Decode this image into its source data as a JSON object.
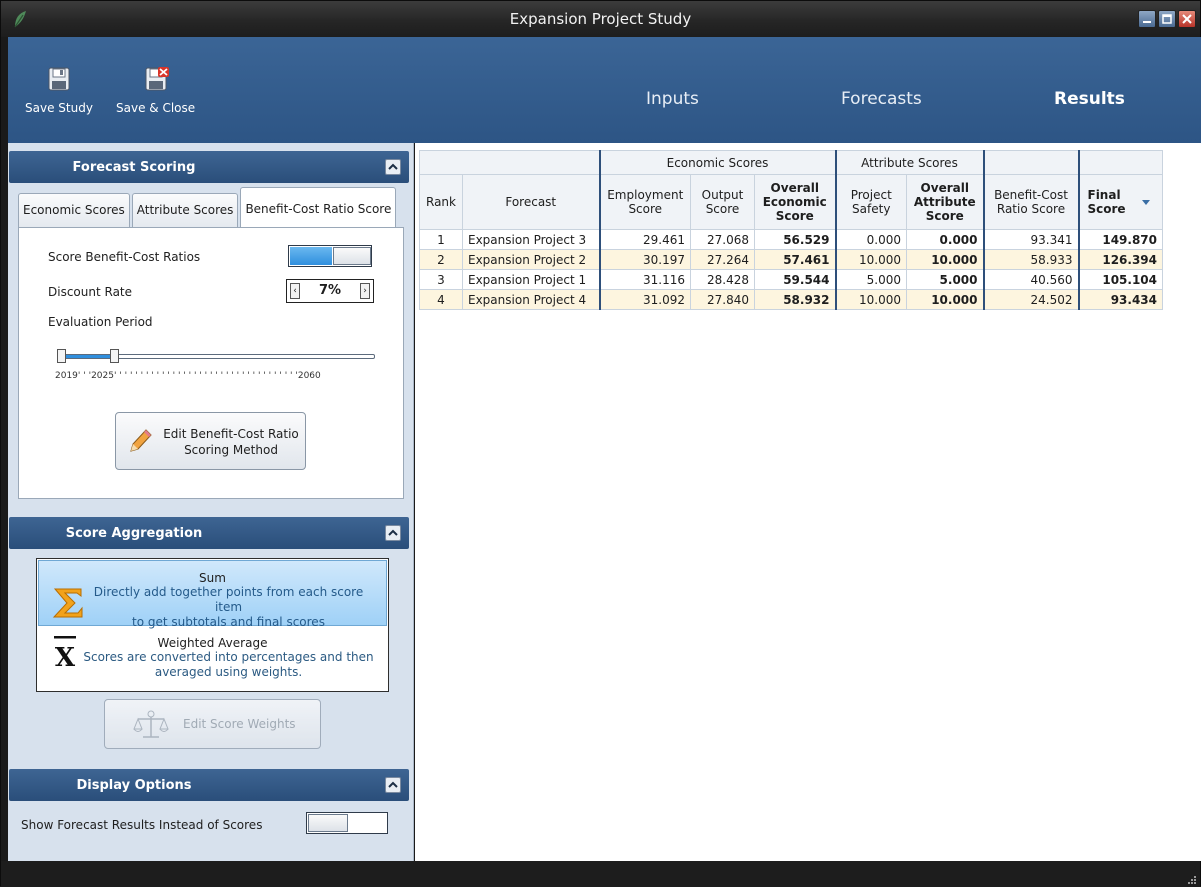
{
  "window": {
    "title": "Expansion Project Study"
  },
  "ribbon": {
    "save_label": "Save Study",
    "save_close_label": "Save & Close",
    "tabs": [
      {
        "label": "Inputs"
      },
      {
        "label": "Forecasts"
      },
      {
        "label": "Results",
        "active": true
      }
    ]
  },
  "forecast_scoring": {
    "title": "Forecast Scoring",
    "tabs": [
      {
        "label": "Economic Scores"
      },
      {
        "label": "Attribute Scores"
      },
      {
        "label": "Benefit-Cost Ratio Score",
        "active": true
      }
    ],
    "score_bcr_label": "Score Benefit-Cost Ratios",
    "score_bcr_on": true,
    "discount_label": "Discount Rate",
    "discount_value": "7%",
    "evaluation_label": "Evaluation Period",
    "period_start": "2019",
    "period_selected": "2025",
    "period_end": "2060",
    "edit_button_line1": "Edit Benefit-Cost Ratio",
    "edit_button_line2": "Scoring Method"
  },
  "score_aggregation": {
    "title": "Score Aggregation",
    "options": [
      {
        "title": "Sum",
        "line1": "Directly add together points from each score item",
        "line2": "to get subtotals and final scores",
        "selected": true
      },
      {
        "title": "Weighted Average",
        "line1": "Scores are converted into percentages and then",
        "line2": "averaged using weights.",
        "selected": false
      }
    ],
    "edit_weights_label": "Edit Score Weights"
  },
  "display_options": {
    "title": "Display Options",
    "show_results_label": "Show Forecast Results Instead of Scores",
    "show_results_on": false
  },
  "table": {
    "groups": {
      "economic": "Economic Scores",
      "attribute": "Attribute Scores"
    },
    "headers": {
      "rank": "Rank",
      "forecast": "Forecast",
      "employment_1": "Employment",
      "employment_2": "Score",
      "output_1": "Output",
      "output_2": "Score",
      "overall_econ_1": "Overall",
      "overall_econ_2": "Economic",
      "overall_econ_3": "Score",
      "safety_1": "Project",
      "safety_2": "Safety",
      "overall_attr_1": "Overall",
      "overall_attr_2": "Attribute",
      "overall_attr_3": "Score",
      "bcr_1": "Benefit-Cost",
      "bcr_2": "Ratio Score",
      "final_1": "Final",
      "final_2": "Score"
    },
    "rows": [
      {
        "rank": "1",
        "forecast": "Expansion Project 3",
        "employment": "29.461",
        "output": "27.068",
        "overall_econ": "56.529",
        "safety": "0.000",
        "overall_attr": "0.000",
        "bcr": "93.341",
        "final": "149.870"
      },
      {
        "rank": "2",
        "forecast": "Expansion Project 2",
        "employment": "30.197",
        "output": "27.264",
        "overall_econ": "57.461",
        "safety": "10.000",
        "overall_attr": "10.000",
        "bcr": "58.933",
        "final": "126.394"
      },
      {
        "rank": "3",
        "forecast": "Expansion Project 1",
        "employment": "31.116",
        "output": "28.428",
        "overall_econ": "59.544",
        "safety": "5.000",
        "overall_attr": "5.000",
        "bcr": "40.560",
        "final": "105.104"
      },
      {
        "rank": "4",
        "forecast": "Expansion Project 4",
        "employment": "31.092",
        "output": "27.840",
        "overall_econ": "58.932",
        "safety": "10.000",
        "overall_attr": "10.000",
        "bcr": "24.502",
        "final": "93.434"
      }
    ]
  },
  "icons": {
    "app": "leaf-icon",
    "save": "floppy-disk-icon",
    "save_close": "floppy-disk-close-icon",
    "collapse": "chevron-up-icon",
    "pencil": "pencil-icon",
    "sum": "sigma-icon",
    "mean": "x-bar-icon",
    "scales": "balance-scale-icon",
    "sort": "sort-down-icon"
  },
  "colors": {
    "ribbon": "#2d5585",
    "section_header": "#2a4e7a",
    "selected_item": "#9fd1f7",
    "alt_row": "#fdf5df",
    "toggle_fill": "#2f8fde"
  }
}
